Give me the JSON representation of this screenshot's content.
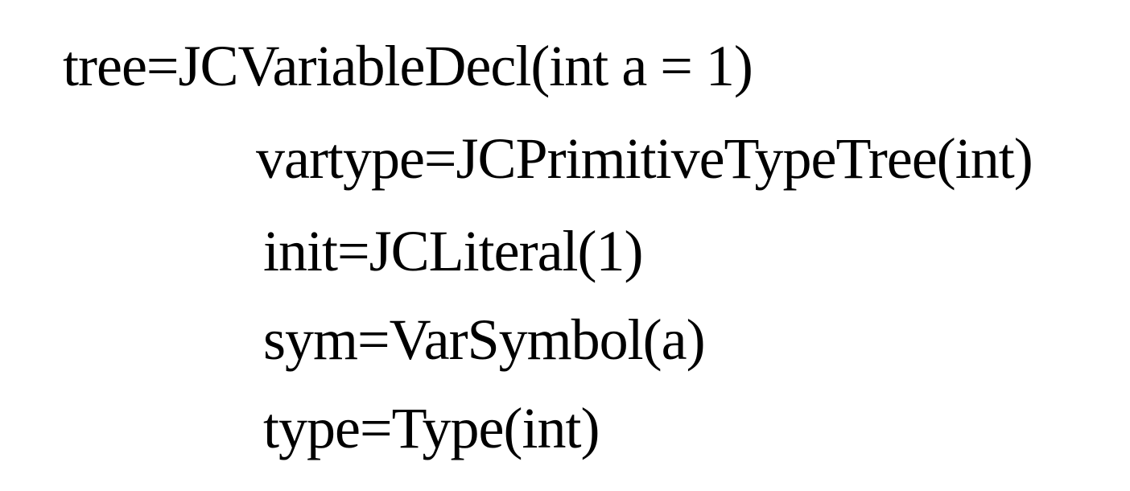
{
  "lines": [
    "tree=JCVariableDecl(int a = 1)",
    "vartype=JCPrimitiveTypeTree(int)",
    "init=JCLiteral(1)",
    "sym=VarSymbol(a)",
    "type=Type(int)"
  ]
}
